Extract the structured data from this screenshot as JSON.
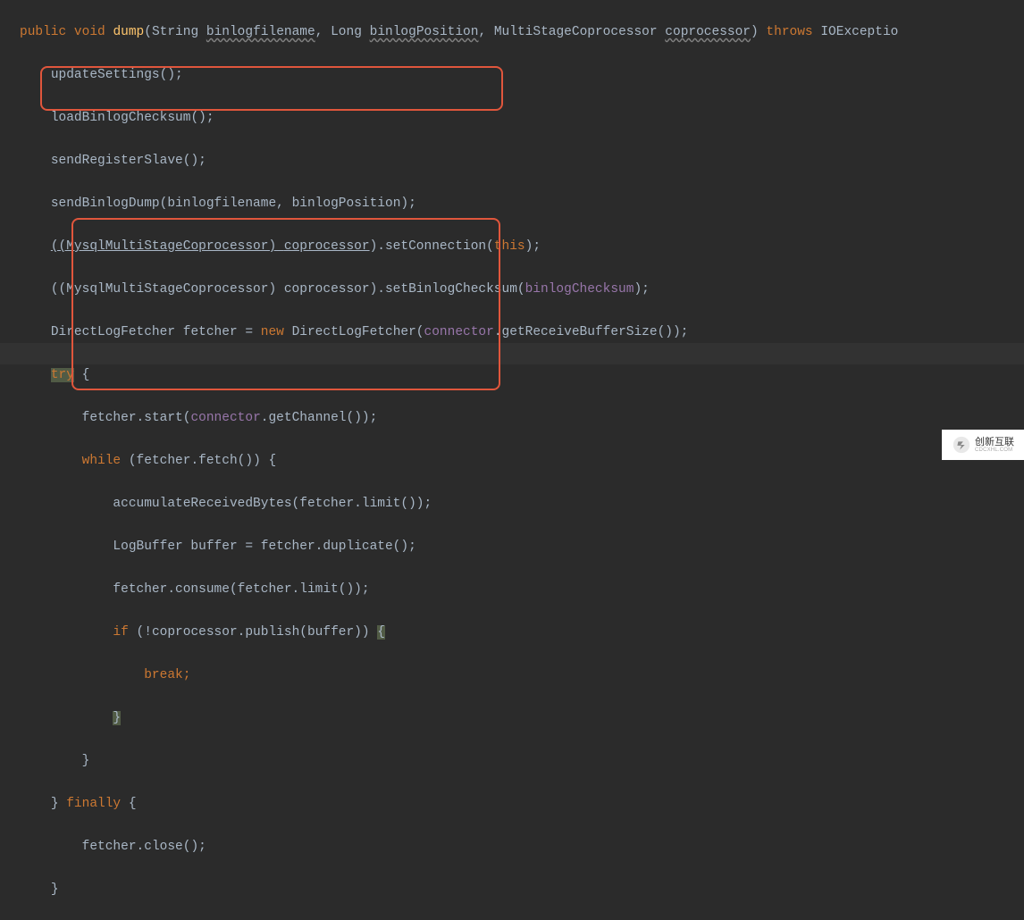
{
  "code": {
    "kw_public": "public",
    "kw_void": "void",
    "method_name": "dump",
    "param_type1": "String",
    "param_name1": "binlogfilename",
    "param_type2": "Long",
    "param_name2": "binlogPosition",
    "param_type3": "MultiStageCoprocessor",
    "param_name3": "coprocessor",
    "kw_throws": "throws",
    "exc_type": "IOExceptio",
    "l2": "updateSettings();",
    "l3": "loadBinlogChecksum();",
    "l4": "sendRegisterSlave();",
    "l5a": "sendBinlogDump(",
    "l5b": "binlogfilename",
    "l5c": ", ",
    "l5d": "binlogPosition",
    "l5e": ");",
    "l6a": "((MysqlMultiStageCoprocessor) ",
    "l6b": "coprocessor",
    "l6c": ").setConnection(",
    "l6d": "this",
    "l6e": ");",
    "l7a": "((MysqlMultiStageCoprocessor) ",
    "l7b": "coprocessor",
    "l7c": ").setBinlogChecksum(",
    "l7d": "binlogChecksum",
    "l7e": ");",
    "l8a": "DirectLogFetcher fetcher = ",
    "l8b": "new",
    "l8c": " DirectLogFetcher(",
    "l8d": "connector",
    "l8e": ".getReceiveBufferSize());",
    "l9a": "try",
    "l9b": " {",
    "l10a": "fetcher.start(",
    "l10b": "connector",
    "l10c": ".getChannel());",
    "l11a": "while",
    "l11b": " (fetcher.fetch()) {",
    "l12": "accumulateReceivedBytes(fetcher.limit());",
    "l13": "LogBuffer buffer = fetcher.duplicate();",
    "l14": "fetcher.consume(fetcher.limit());",
    "l15a": "if",
    "l15b": " (!",
    "l15c": "coprocessor",
    "l15d": ".publish(buffer)) ",
    "l15e": "{",
    "l16a": "break",
    "l16b": ";",
    "l17": "}",
    "l18": "}",
    "l19a": "} ",
    "l19b": "finally",
    "l19c": " {",
    "l20": "fetcher.close();",
    "l21": "}"
  },
  "watermark": {
    "cn": "创新互联",
    "en": "CDCXHL.COM"
  }
}
